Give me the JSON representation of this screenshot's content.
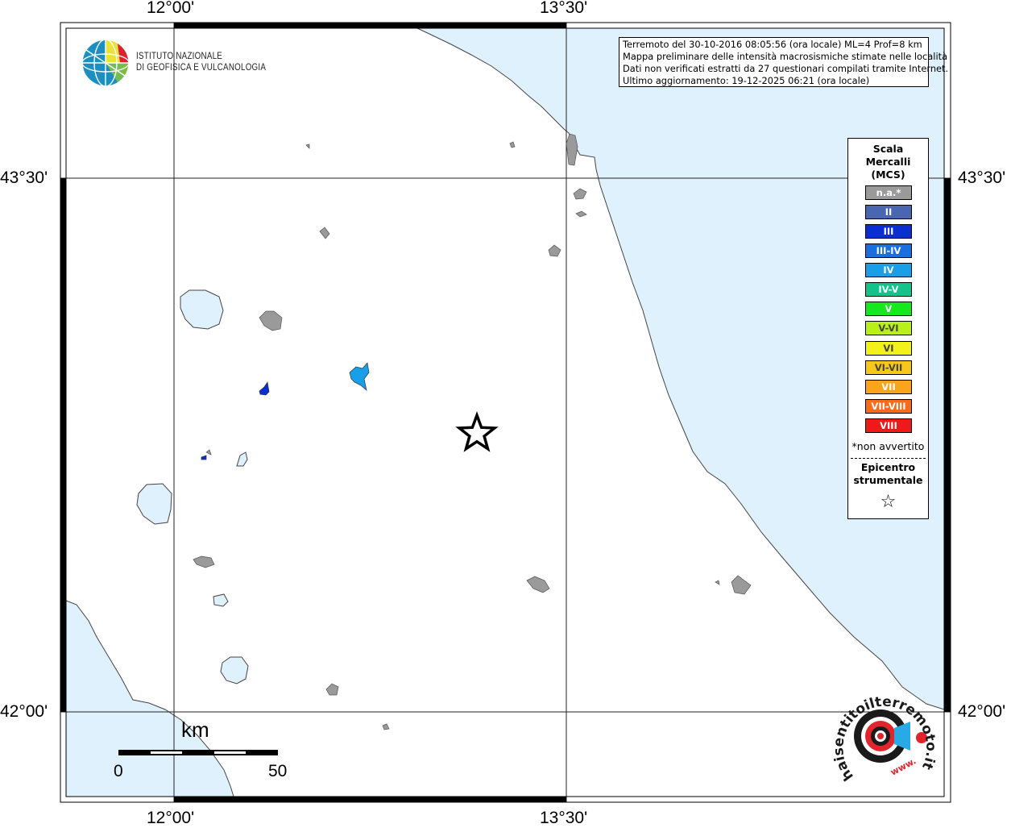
{
  "map_labels": {
    "lon_left": "12°00'",
    "lon_right": "13°30'",
    "lat_top": "43°30'",
    "lat_bottom": "42°00'"
  },
  "logo": {
    "line1": "ISTITUTO NAZIONALE",
    "line2": "DI GEOFISICA E VULCANOLOGIA"
  },
  "info": {
    "line1": "Terremoto del 30-10-2016 08:05:56 (ora locale) ML=4 Prof=8 km",
    "line2": "Mappa preliminare delle intensità macrosismiche stimate nelle località",
    "line3": "Dati non verificati estratti da 27 questionari compilati tramite Internet.",
    "line4": "Ultimo aggiornamento: 19-12-2025 06:21 (ora locale)"
  },
  "legend": {
    "title1": "Scala",
    "title2": "Mercalli",
    "title3": "(MCS)",
    "items": [
      {
        "label": "n.a.*",
        "color": "#9a9a9a"
      },
      {
        "label": "II",
        "color": "#4a66b0"
      },
      {
        "label": "III",
        "color": "#0a2fd0"
      },
      {
        "label": "III-IV",
        "color": "#1a6fe0"
      },
      {
        "label": "IV",
        "color": "#199fe8"
      },
      {
        "label": "IV-V",
        "color": "#12c48a"
      },
      {
        "label": "V",
        "color": "#16e81e"
      },
      {
        "label": "V-VI",
        "color": "#b9f01c"
      },
      {
        "label": "VI",
        "color": "#f2f21a"
      },
      {
        "label": "VI-VII",
        "color": "#f7c81b"
      },
      {
        "label": "VII",
        "color": "#f9a41b"
      },
      {
        "label": "VII-VIII",
        "color": "#f96b1a"
      },
      {
        "label": "VIII",
        "color": "#ee1a1a"
      }
    ],
    "note": "*non avvertito",
    "epicenter1": "Epicentro",
    "epicenter2": "strumentale",
    "epicenter_symbol": "☆"
  },
  "scale": {
    "unit": "km",
    "start": "0",
    "end": "50"
  },
  "watermark": {
    "text": "haisentitoilterremoto.it",
    "prefix": "www."
  },
  "colors": {
    "sea": "#dff1fc",
    "land": "#ffffff",
    "lake": "#dff1fc",
    "locality_na": "#9a9a9a",
    "locality_iii": "#0a2fd0",
    "locality_iv": "#199fe8",
    "frame": "#000000"
  }
}
